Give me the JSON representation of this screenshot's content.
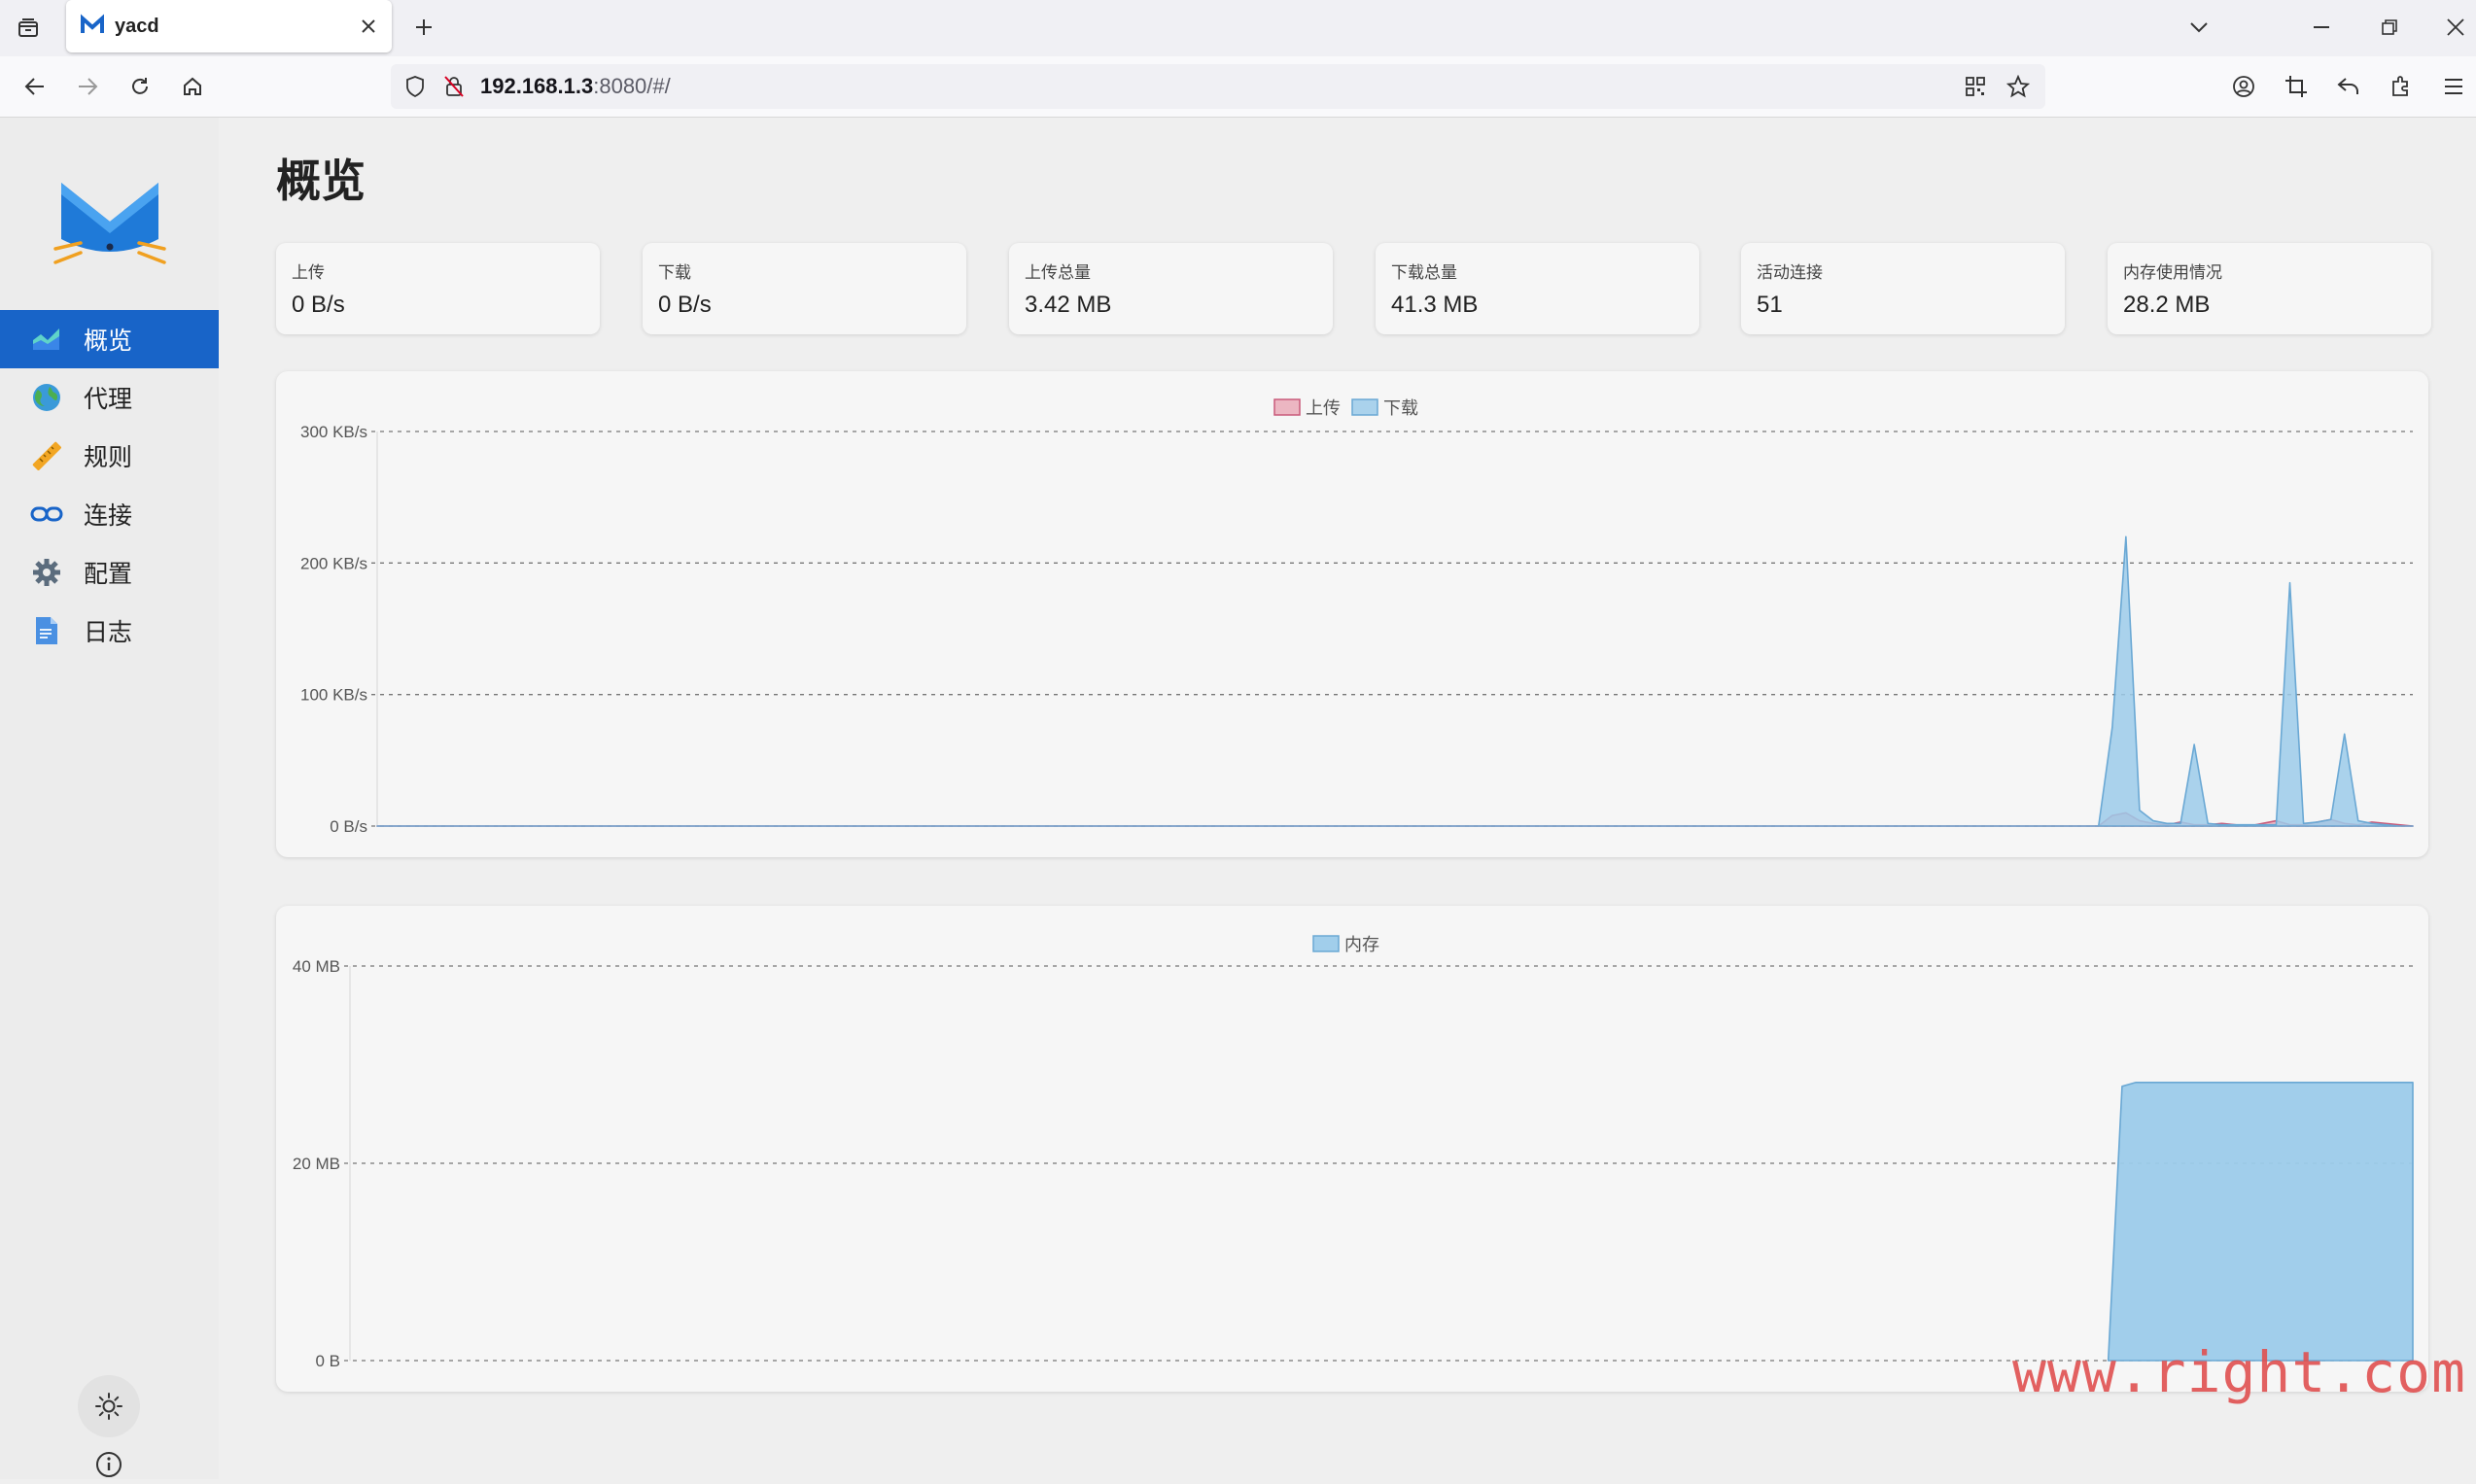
{
  "browser": {
    "tab_title": "yacd",
    "url_host": "192.168.1.3",
    "url_rest": ":8080/#/"
  },
  "sidebar": {
    "items": [
      {
        "label": "概览",
        "icon": "overview-chart-icon",
        "active": true
      },
      {
        "label": "代理",
        "icon": "globe-icon",
        "active": false
      },
      {
        "label": "规则",
        "icon": "ruler-icon",
        "active": false
      },
      {
        "label": "连接",
        "icon": "link-chain-icon",
        "active": false
      },
      {
        "label": "配置",
        "icon": "gear-icon",
        "active": false
      },
      {
        "label": "日志",
        "icon": "document-icon",
        "active": false
      }
    ]
  },
  "main": {
    "title": "概览",
    "stats": [
      {
        "label": "上传",
        "value": "0 B/s"
      },
      {
        "label": "下载",
        "value": "0 B/s"
      },
      {
        "label": "上传总量",
        "value": "3.42 MB"
      },
      {
        "label": "下载总量",
        "value": "41.3 MB"
      },
      {
        "label": "活动连接",
        "value": "51"
      },
      {
        "label": "内存使用情况",
        "value": "28.2 MB"
      }
    ]
  },
  "colors": {
    "upload": "#e8a0b0",
    "upload_stroke": "#c95a7a",
    "download": "#9ccbea",
    "download_stroke": "#6aa8d4",
    "memory": "#9ccbea",
    "accent": "#1864c8"
  },
  "chart_data": [
    {
      "type": "area",
      "legend_placement": "top-center",
      "grid": true,
      "ylim": [
        0,
        300
      ],
      "yticks": [
        "300 KB/s",
        "200 KB/s",
        "100 KB/s",
        "0 B/s"
      ],
      "ytick_values": [
        300,
        200,
        100,
        0
      ],
      "points": 150,
      "series": [
        {
          "name": "上传",
          "values": [
            0,
            0,
            0,
            0,
            0,
            0,
            0,
            0,
            0,
            0,
            0,
            0,
            0,
            0,
            0,
            0,
            0,
            0,
            0,
            0,
            0,
            0,
            0,
            0,
            0,
            0,
            0,
            0,
            0,
            0,
            0,
            0,
            0,
            0,
            0,
            0,
            0,
            0,
            0,
            0,
            0,
            0,
            0,
            0,
            0,
            0,
            0,
            0,
            0,
            0,
            0,
            0,
            0,
            0,
            0,
            0,
            0,
            0,
            0,
            0,
            0,
            0,
            0,
            0,
            0,
            0,
            0,
            0,
            0,
            0,
            0,
            0,
            0,
            0,
            0,
            0,
            0,
            0,
            0,
            0,
            0,
            0,
            0,
            0,
            0,
            0,
            0,
            0,
            0,
            0,
            0,
            0,
            0,
            0,
            0,
            0,
            0,
            0,
            0,
            0,
            0,
            0,
            0,
            0,
            0,
            0,
            0,
            0,
            0,
            0,
            0,
            0,
            0,
            0,
            0,
            0,
            0,
            0,
            0,
            0,
            0,
            0,
            0,
            0,
            0,
            0,
            0,
            8,
            10,
            4,
            2,
            1,
            3,
            1,
            1,
            2,
            1,
            0,
            2,
            4,
            1,
            1,
            3,
            5,
            2,
            1,
            3,
            2,
            1,
            0
          ]
        },
        {
          "name": "下载",
          "values": [
            0,
            0,
            0,
            0,
            0,
            0,
            0,
            0,
            0,
            0,
            0,
            0,
            0,
            0,
            0,
            0,
            0,
            0,
            0,
            0,
            0,
            0,
            0,
            0,
            0,
            0,
            0,
            0,
            0,
            0,
            0,
            0,
            0,
            0,
            0,
            0,
            0,
            0,
            0,
            0,
            0,
            0,
            0,
            0,
            0,
            0,
            0,
            0,
            0,
            0,
            0,
            0,
            0,
            0,
            0,
            0,
            0,
            0,
            0,
            0,
            0,
            0,
            0,
            0,
            0,
            0,
            0,
            0,
            0,
            0,
            0,
            0,
            0,
            0,
            0,
            0,
            0,
            0,
            0,
            0,
            0,
            0,
            0,
            0,
            0,
            0,
            0,
            0,
            0,
            0,
            0,
            0,
            0,
            0,
            0,
            0,
            0,
            0,
            0,
            0,
            0,
            0,
            0,
            0,
            0,
            0,
            0,
            0,
            0,
            0,
            0,
            0,
            0,
            0,
            0,
            0,
            0,
            0,
            0,
            0,
            0,
            0,
            0,
            0,
            0,
            0,
            0,
            75,
            220,
            12,
            4,
            2,
            2,
            62,
            2,
            1,
            1,
            1,
            1,
            1,
            185,
            2,
            3,
            5,
            70,
            4,
            2,
            1,
            0,
            0
          ]
        }
      ]
    },
    {
      "type": "area",
      "legend_placement": "top-center",
      "grid": true,
      "ylim": [
        0,
        40
      ],
      "yticks": [
        "40 MB",
        "20 MB",
        "0 B"
      ],
      "ytick_values": [
        40,
        20,
        0
      ],
      "points": 150,
      "series": [
        {
          "name": "内存",
          "values": [
            null,
            null,
            null,
            null,
            null,
            null,
            null,
            null,
            null,
            null,
            null,
            null,
            null,
            null,
            null,
            null,
            null,
            null,
            null,
            null,
            null,
            null,
            null,
            null,
            null,
            null,
            null,
            null,
            null,
            null,
            null,
            null,
            null,
            null,
            null,
            null,
            null,
            null,
            null,
            null,
            null,
            null,
            null,
            null,
            null,
            null,
            null,
            null,
            null,
            null,
            null,
            null,
            null,
            null,
            null,
            null,
            null,
            null,
            null,
            null,
            null,
            null,
            null,
            null,
            null,
            null,
            null,
            null,
            null,
            null,
            null,
            null,
            null,
            null,
            null,
            null,
            null,
            null,
            null,
            null,
            null,
            null,
            null,
            null,
            null,
            null,
            null,
            null,
            null,
            null,
            null,
            null,
            null,
            null,
            null,
            null,
            null,
            null,
            null,
            null,
            null,
            null,
            null,
            null,
            null,
            null,
            null,
            null,
            null,
            null,
            null,
            null,
            null,
            null,
            null,
            null,
            null,
            null,
            null,
            null,
            null,
            null,
            null,
            null,
            null,
            null,
            null,
            0,
            27.8,
            28.2,
            28.2,
            28.2,
            28.2,
            28.2,
            28.2,
            28.2,
            28.2,
            28.2,
            28.2,
            28.2,
            28.2,
            28.2,
            28.2,
            28.2,
            28.2,
            28.2,
            28.2,
            28.2,
            28.2,
            28.2
          ]
        }
      ]
    }
  ],
  "watermark": "www.right.com.cn"
}
